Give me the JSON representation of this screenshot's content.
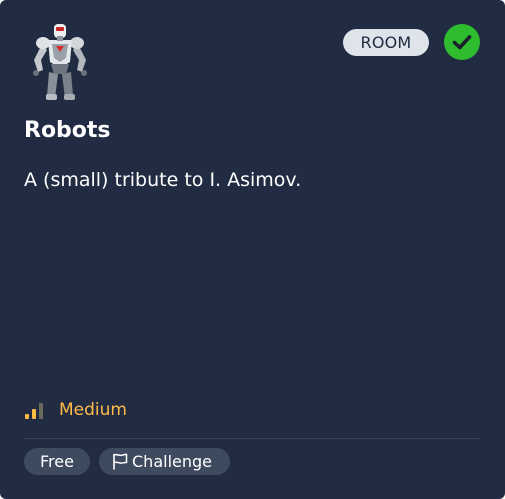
{
  "room": {
    "type_badge": "ROOM",
    "completed": true,
    "title": "Robots",
    "description": "A (small) tribute to I. Asimov.",
    "difficulty": "Medium",
    "difficulty_level": 2,
    "difficulty_max": 3,
    "tags": {
      "price": "Free",
      "kind": "Challenge"
    }
  },
  "colors": {
    "card_bg": "#212c42",
    "difficulty_accent": "#ffbb45",
    "completed_green": "#2fbd2f",
    "badge_bg": "#dfe3ea",
    "pill_bg": "#3e4a5e"
  },
  "icons": {
    "completed": "check-circle-icon",
    "difficulty": "signal-bars-icon",
    "challenge": "flag-icon",
    "thumbnail": "robot-icon"
  }
}
